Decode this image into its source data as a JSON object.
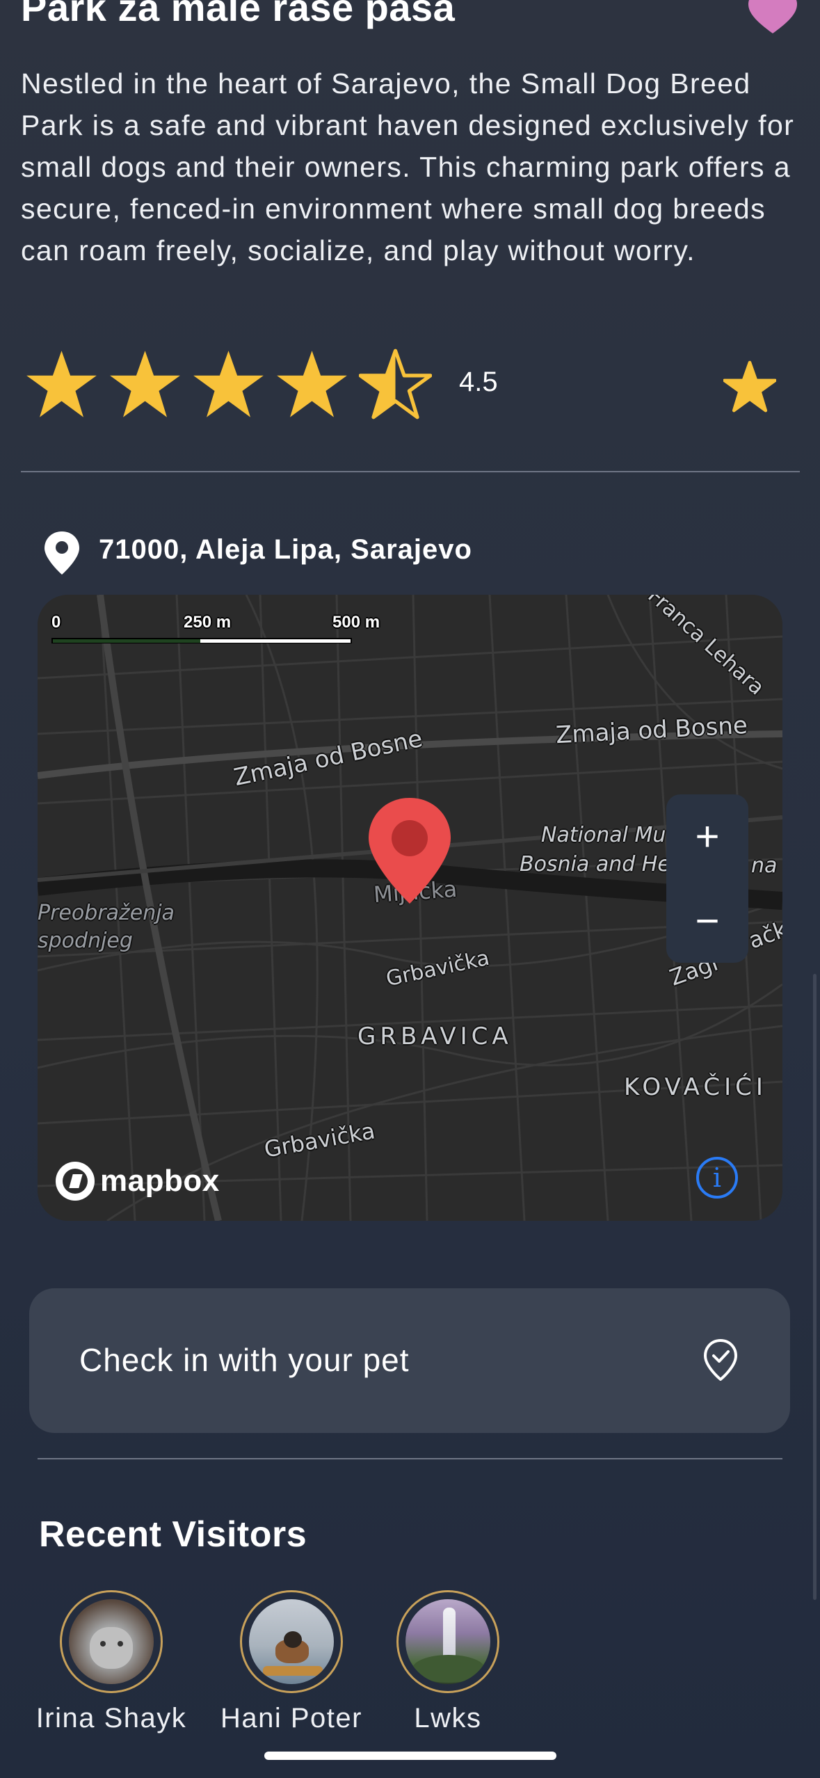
{
  "park": {
    "title": "Park za male rase pasa",
    "description": "Nestled in the heart of Sarajevo, the Small Dog Breed Park is a safe and vibrant haven designed exclusively for small dogs and their owners. This charming park offers a secure, fenced-in environment where small dog breeds can roam freely, socialize, and play without worry.",
    "rating": 4.5,
    "rating_text": "4.5",
    "max_rating": 5,
    "address": "71000, Aleja Lipa, Sarajevo"
  },
  "map": {
    "labels": {
      "zmaja_left": "Zmaja od Bosne",
      "zmaja_right": "Zmaja od Bosne",
      "franca": "Franca Lehara",
      "museum_1": "National Mu",
      "museum_2": "Bosnia and He",
      "museum_tail": "na",
      "migacka": "Mijacka",
      "preob_1": "Preobraženja",
      "preob_2": "spodnjeg",
      "grbavicka_1": "Grbavička",
      "grbavicka_2": "Grbavička",
      "grbavica": "GRBAVICA",
      "kovacici": "KOVAČIĆI",
      "zagreb": "Zagr",
      "zagreb_tail": "ačk"
    },
    "scale": {
      "zero": "0",
      "mid": "250 m",
      "end": "500 m"
    },
    "zoom_in": "+",
    "zoom_out": "−",
    "attribution_logo": "mapbox",
    "info_icon": "i"
  },
  "checkin": {
    "label": "Check in with your pet"
  },
  "visitors": {
    "title": "Recent Visitors",
    "items": [
      {
        "name": "Irina Shayk"
      },
      {
        "name": "Hani Poter"
      },
      {
        "name": "Lwks"
      }
    ]
  },
  "colors": {
    "star": "#f8c23a",
    "heart": "#d47cbf",
    "pin": "#e84e4e",
    "info": "#2a7bf5",
    "card": "#3b4352"
  }
}
